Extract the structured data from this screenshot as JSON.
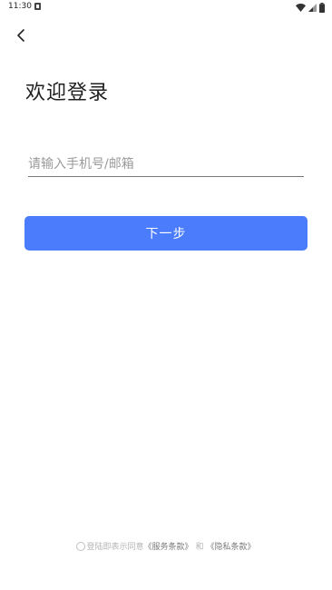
{
  "status_bar": {
    "time": "11:30",
    "icons": [
      "notification-icon",
      "wifi-icon",
      "signal-icon",
      "battery-icon"
    ]
  },
  "nav": {
    "back_icon": "chevron-left-icon"
  },
  "login": {
    "title": "欢迎登录",
    "account_input": {
      "value": "",
      "placeholder": "请输入手机号/邮箱"
    },
    "next_label": "下一步"
  },
  "agreement": {
    "prefix": "登陆即表示同意",
    "terms_link": "《服务条款》",
    "joiner": "和",
    "privacy_link": "《隐私条款》"
  },
  "colors": {
    "primary": "#4a7cfb",
    "background": "#ffffff",
    "text": "#1f1f1f",
    "placeholder": "#9a9a9a"
  }
}
